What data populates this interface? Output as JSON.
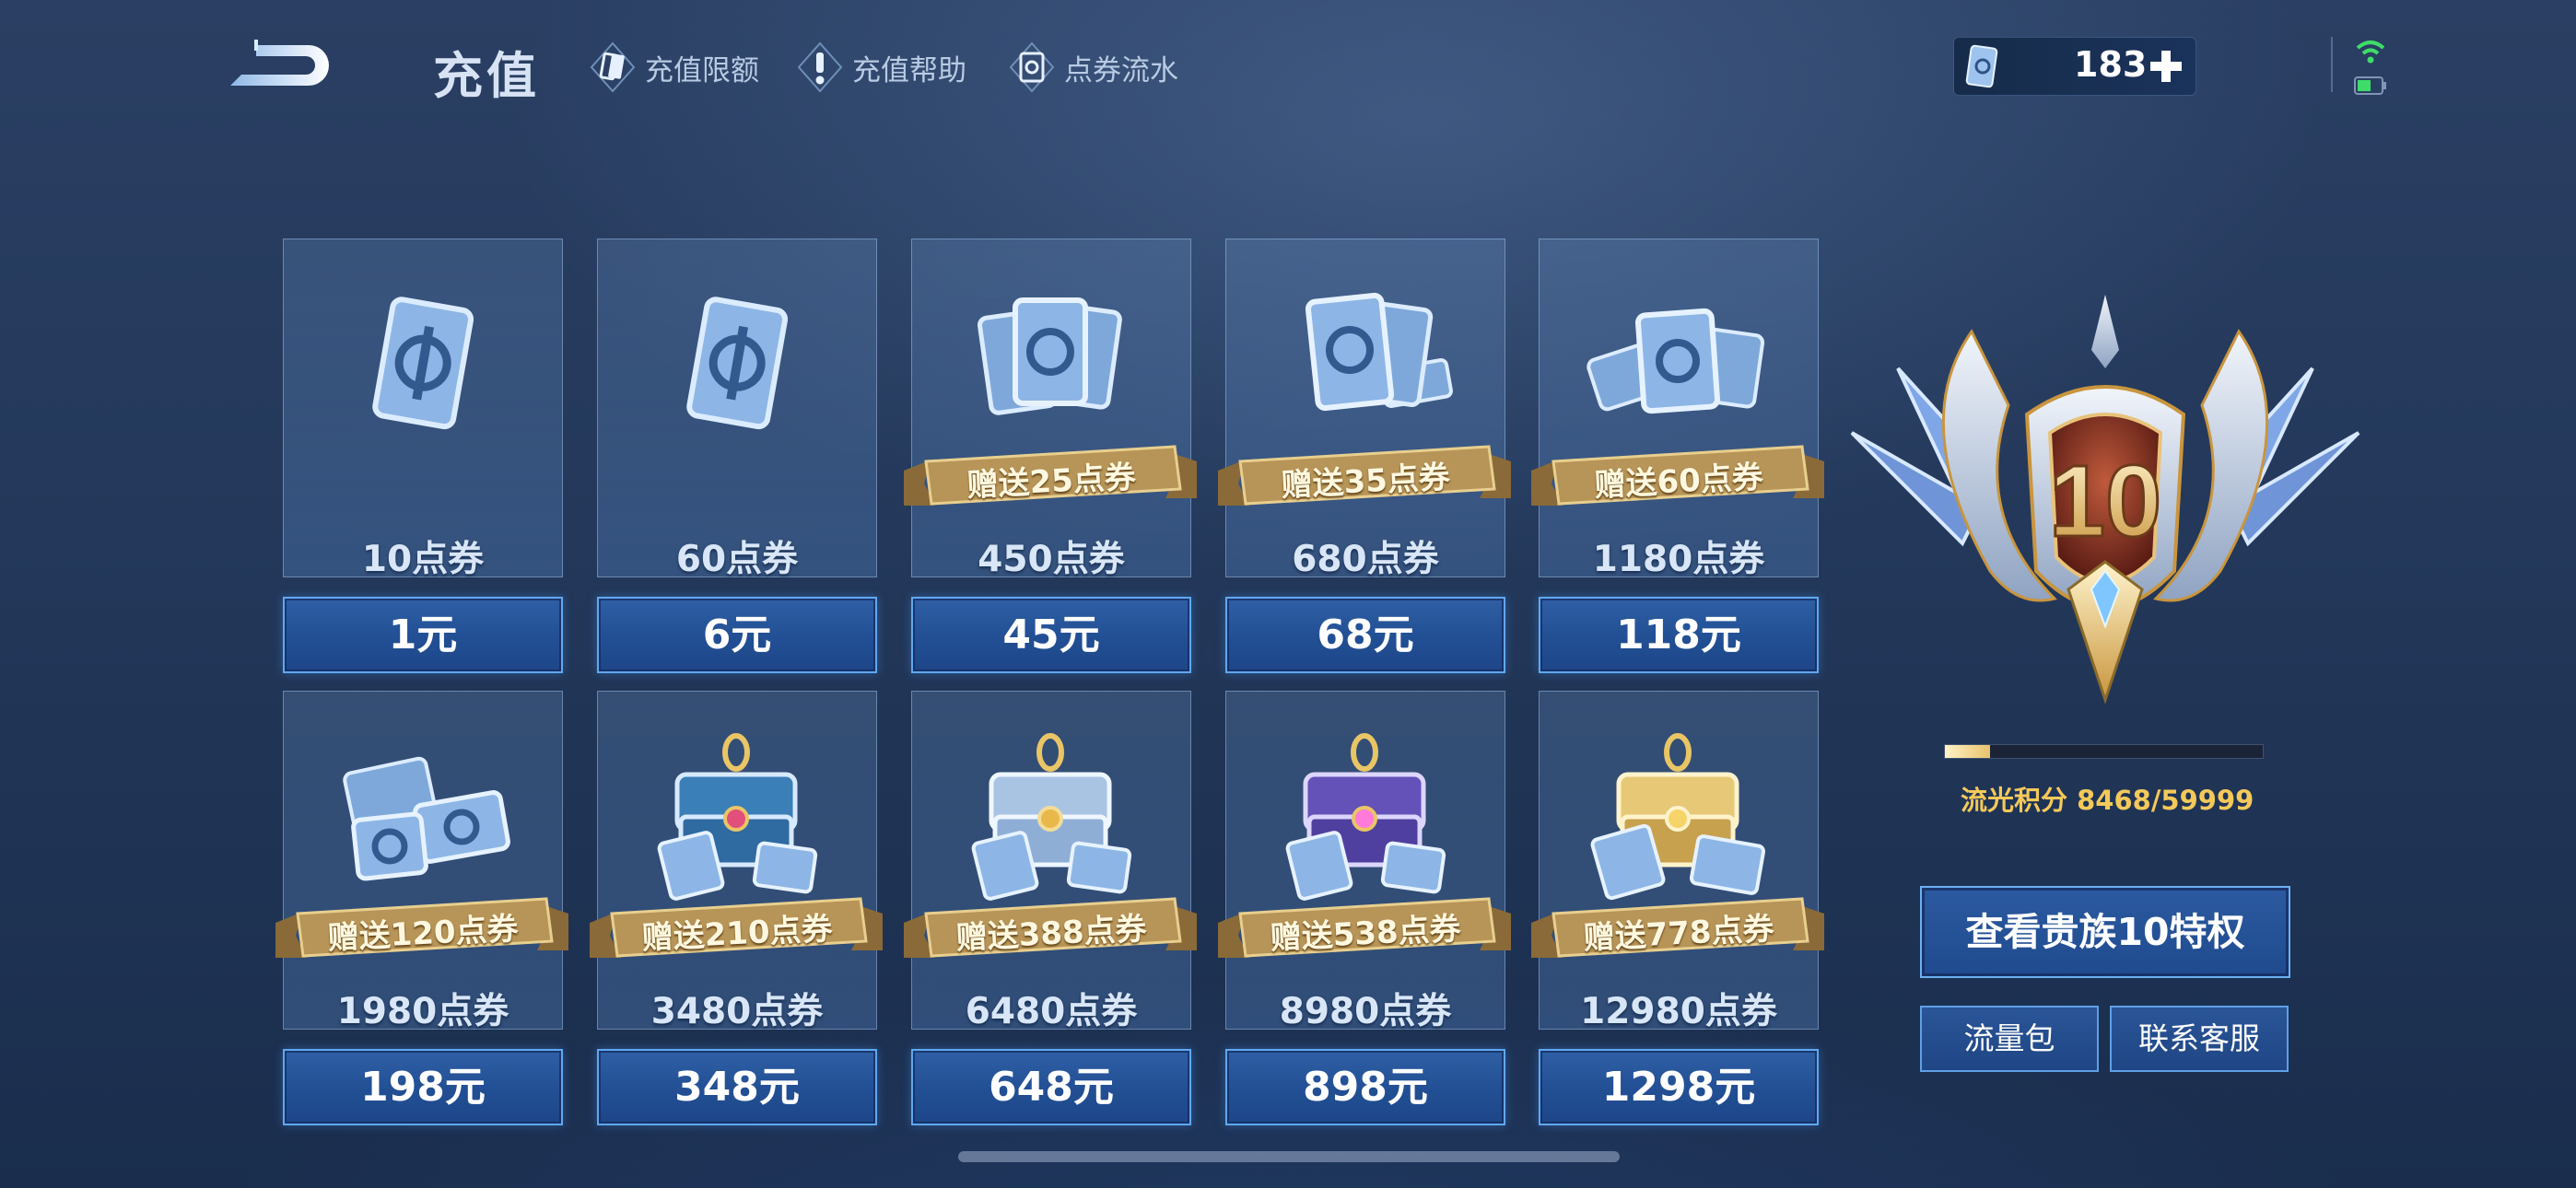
{
  "header": {
    "title": "充值",
    "nav": [
      {
        "label": "充值限额",
        "icon": "card-icon"
      },
      {
        "label": "充值帮助",
        "icon": "exclamation-icon"
      },
      {
        "label": "点券流水",
        "icon": "voucher-flow-icon"
      }
    ],
    "balance": "183"
  },
  "packs": [
    {
      "points": "10点券",
      "price": "1元",
      "bonus": "",
      "art": "single-voucher"
    },
    {
      "points": "60点券",
      "price": "6元",
      "bonus": "",
      "art": "single-voucher"
    },
    {
      "points": "450点券",
      "price": "45元",
      "bonus": "赠送25点券",
      "art": "voucher-stack"
    },
    {
      "points": "680点券",
      "price": "68元",
      "bonus": "赠送35点券",
      "art": "voucher-stack"
    },
    {
      "points": "1180点券",
      "price": "118元",
      "bonus": "赠送60点券",
      "art": "voucher-pile"
    },
    {
      "points": "1980点券",
      "price": "198元",
      "bonus": "赠送120点券",
      "art": "voucher-pile"
    },
    {
      "points": "3480点券",
      "price": "348元",
      "bonus": "赠送210点券",
      "art": "blue-chest"
    },
    {
      "points": "6480点券",
      "price": "648元",
      "bonus": "赠送388点券",
      "art": "silver-chest"
    },
    {
      "points": "8980点券",
      "price": "898元",
      "bonus": "赠送538点券",
      "art": "purple-chest"
    },
    {
      "points": "12980点券",
      "price": "1298元",
      "bonus": "赠送778点券",
      "art": "gold-chest"
    }
  ],
  "noble": {
    "level": "10",
    "progress": 0.141,
    "score_label": "流光积分",
    "score_value": "8468/59999",
    "privilege_button": "查看贵族10特权",
    "data_pack_button": "流量包",
    "support_button": "联系客服"
  },
  "colors": {
    "accent_blue": "#5fa8f0",
    "gold": "#f4c95a",
    "ribbon": "#b08a4e",
    "wifi": "#3fdc6a"
  }
}
